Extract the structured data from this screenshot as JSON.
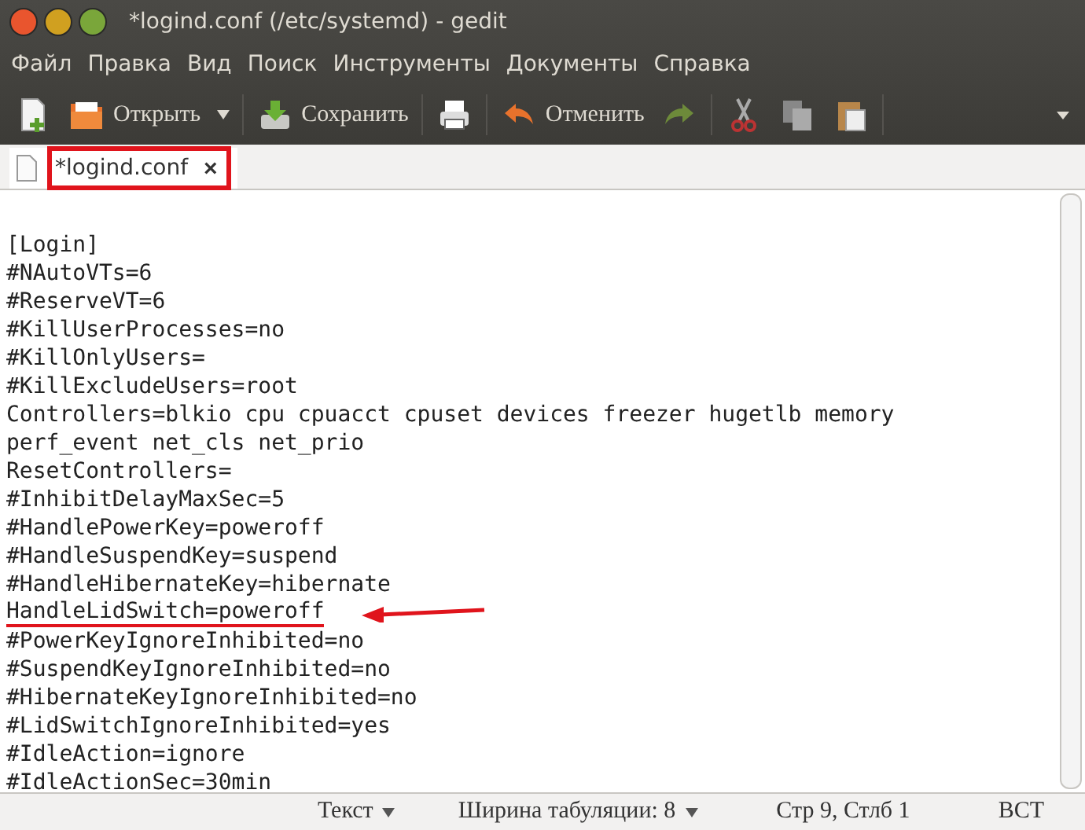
{
  "window": {
    "title": "*logind.conf (/etc/systemd) - gedit"
  },
  "menu": [
    "Файл",
    "Правка",
    "Вид",
    "Поиск",
    "Инструменты",
    "Документы",
    "Справка"
  ],
  "toolbar": [
    {
      "kind": "new"
    },
    {
      "kind": "open",
      "label": "Открыть",
      "dropdown": true
    },
    {
      "kind": "save",
      "label": "Сохранить"
    },
    {
      "kind": "print"
    },
    {
      "kind": "undo",
      "label": "Отменить"
    },
    {
      "kind": "redo"
    },
    {
      "kind": "cut"
    },
    {
      "kind": "copy"
    },
    {
      "kind": "paste"
    },
    {
      "kind": "more"
    }
  ],
  "tabs": [
    {
      "label": "*logind.conf",
      "selected": true,
      "marked": true,
      "close": "×"
    }
  ],
  "lines": [
    {
      "text": "[Login]",
      "marked": false
    },
    {
      "text": "#NAutoVTs=6",
      "marked": false
    },
    {
      "text": "#ReserveVT=6",
      "marked": false
    },
    {
      "text": "#KillUserProcesses=no",
      "marked": false
    },
    {
      "text": "#KillOnlyUsers=",
      "marked": false
    },
    {
      "text": "#KillExcludeUsers=root",
      "marked": false
    },
    {
      "text": "Controllers=blkio cpu cpuacct cpuset devices freezer hugetlb memory",
      "marked": false
    },
    {
      "text": "perf_event net_cls net_prio",
      "marked": false
    },
    {
      "text": "ResetControllers=",
      "marked": false
    },
    {
      "text": "#InhibitDelayMaxSec=5",
      "marked": false
    },
    {
      "text": "#HandlePowerKey=poweroff",
      "marked": false
    },
    {
      "text": "#HandleSuspendKey=suspend",
      "marked": false
    },
    {
      "text": "#HandleHibernateKey=hibernate",
      "marked": false
    },
    {
      "text": "HandleLidSwitch=poweroff",
      "marked": true
    },
    {
      "text": "#PowerKeyIgnoreInhibited=no",
      "marked": false
    },
    {
      "text": "#SuspendKeyIgnoreInhibited=no",
      "marked": false
    },
    {
      "text": "#HibernateKeyIgnoreInhibited=no",
      "marked": false
    },
    {
      "text": "#LidSwitchIgnoreInhibited=yes",
      "marked": false
    },
    {
      "text": "#IdleAction=ignore",
      "marked": false
    },
    {
      "text": "#IdleActionSec=30min",
      "marked": false
    }
  ],
  "status_bar": {
    "language": "Текст",
    "tab_width": "Ширина табуляции: 8",
    "position": "Стр 9, Стлб 1",
    "mode": "ВСТ"
  }
}
